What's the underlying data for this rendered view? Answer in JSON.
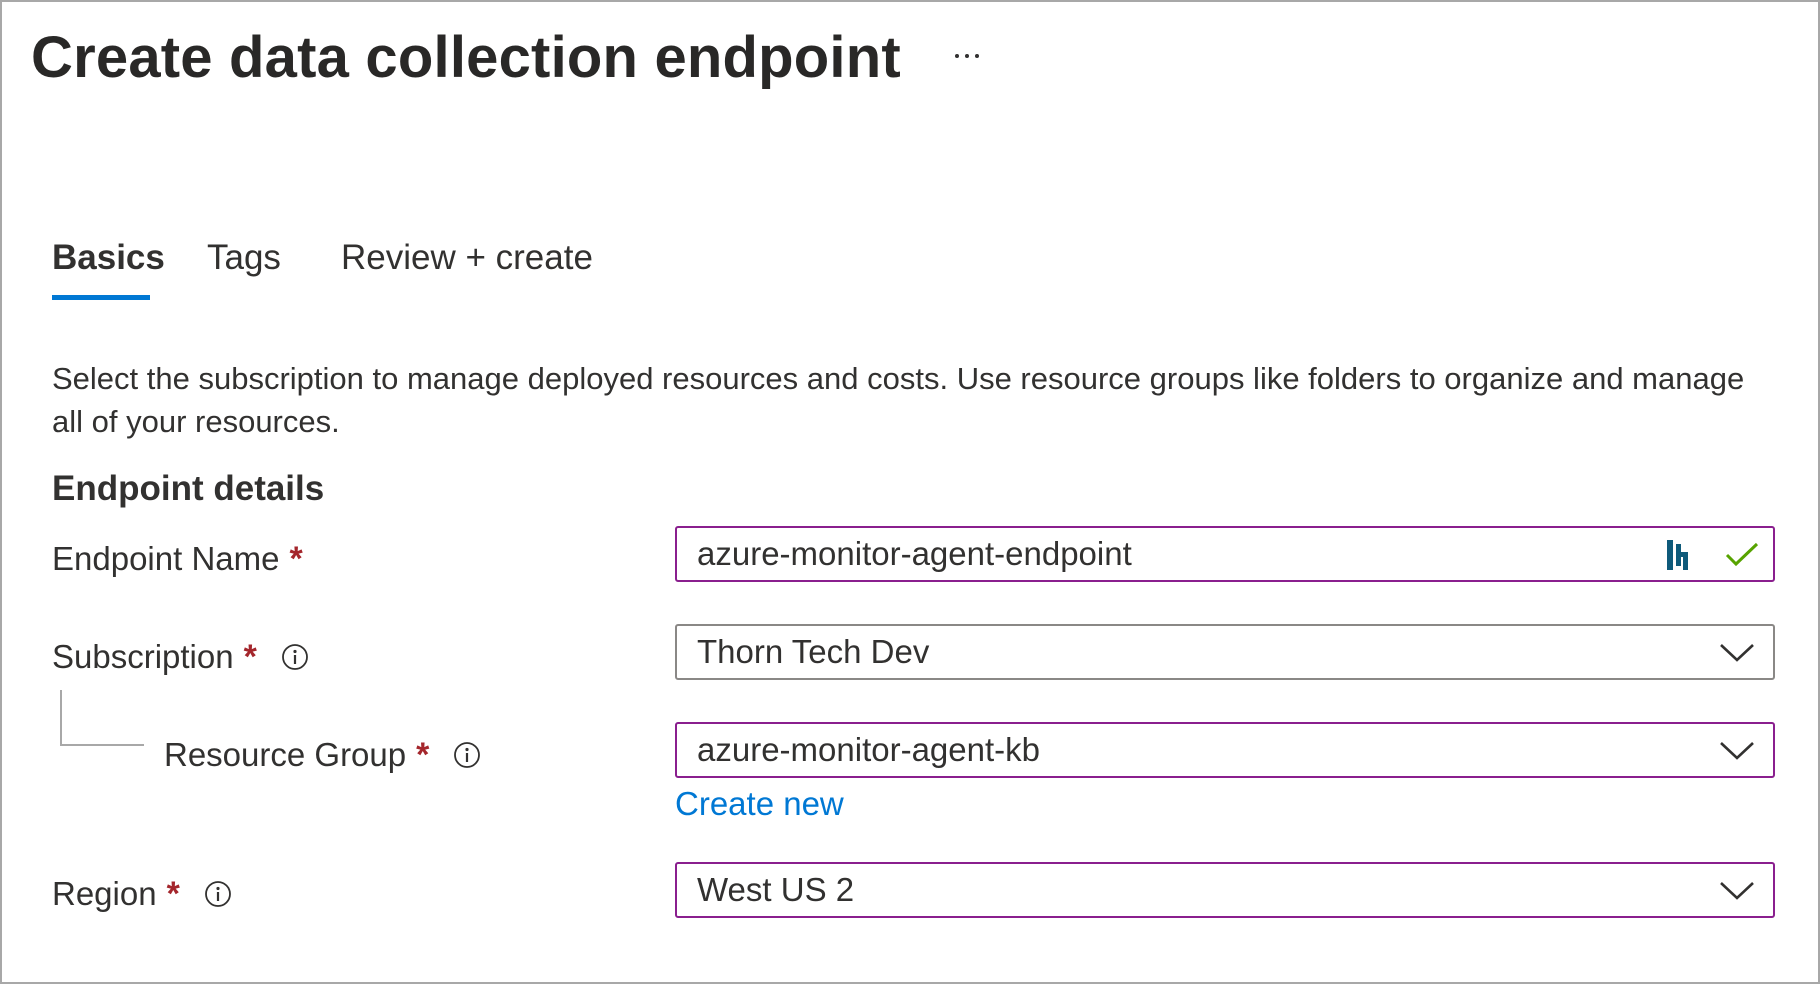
{
  "header": {
    "title": "Create data collection endpoint",
    "more_label": "..."
  },
  "tabs": [
    {
      "label": "Basics",
      "active": true
    },
    {
      "label": "Tags",
      "active": false
    },
    {
      "label": "Review + create",
      "active": false
    }
  ],
  "intro_text": "Select the subscription to manage deployed resources and costs. Use resource groups like folders to organize and manage all of your resources.",
  "section_title": "Endpoint details",
  "required_marker": "*",
  "form": {
    "endpoint_name": {
      "label": "Endpoint Name",
      "value": "azure-monitor-agent-endpoint",
      "valid": true
    },
    "subscription": {
      "label": "Subscription",
      "value": "Thorn Tech Dev"
    },
    "resource_group": {
      "label": "Resource Group",
      "value": "azure-monitor-agent-kb",
      "create_new_label": "Create new"
    },
    "region": {
      "label": "Region",
      "value": "West US 2"
    }
  },
  "colors": {
    "accent": "#0078d4",
    "required": "#a4262c",
    "focus_border": "#8a1f8e",
    "valid_check": "#57a300",
    "extension_icon": "#0e5a7a"
  },
  "icons": {
    "info": "info-icon",
    "chevron": "chevron-down-icon",
    "valid": "checkmark-icon",
    "extension": "password-manager-icon",
    "more": "more-icon"
  }
}
